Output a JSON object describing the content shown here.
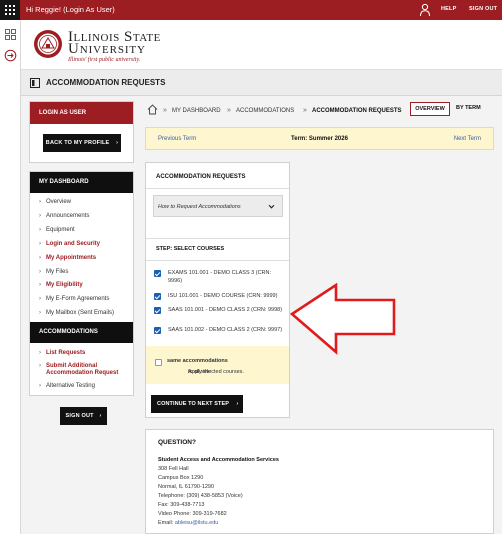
{
  "topbar": {
    "greeting": "Hi Reggie! (Login As User)",
    "help": "HELP",
    "sign_out": "SIGN OUT"
  },
  "header": {
    "wordmark_line1": "Illinois State",
    "wordmark_line2": "University",
    "tagline": "Illinois' first public university."
  },
  "page_title": "ACCOMMODATION REQUESTS",
  "sidebar": {
    "login_as_user": "LOGIN AS USER",
    "back_button": "BACK TO MY PROFILE",
    "dashboard_heading": "MY DASHBOARD",
    "dashboard_items": [
      {
        "label": "Overview",
        "highlight": false
      },
      {
        "label": "Announcements",
        "highlight": false
      },
      {
        "label": "Equipment",
        "highlight": false
      },
      {
        "label": "Login and Security",
        "highlight": true
      },
      {
        "label": "My Appointments",
        "highlight": true
      },
      {
        "label": "My Files",
        "highlight": false
      },
      {
        "label": "My Eligibility",
        "highlight": true
      },
      {
        "label": "My E-Form Agreements",
        "highlight": false
      },
      {
        "label": "My Mailbox (Sent Emails)",
        "highlight": false
      }
    ],
    "accommodations_heading": "ACCOMMODATIONS",
    "accommodation_items": [
      {
        "label": "List Requests",
        "highlight": true
      },
      {
        "label_line1": "Submit Additional",
        "label_line2": "Accommodation Request",
        "highlight": true
      },
      {
        "label": "Alternative Testing",
        "highlight": false
      }
    ],
    "sign_out_button": "SIGN OUT"
  },
  "breadcrumb": {
    "items": [
      "MY DASHBOARD",
      "ACCOMMODATIONS",
      "ACCOMMODATION REQUESTS"
    ],
    "separator": "»"
  },
  "view_toggle": {
    "overview": "OVERVIEW",
    "by_term": "BY TERM"
  },
  "term_bar": {
    "previous": "Previous Term",
    "current": "Term: Summer 2026",
    "next": "Next Term"
  },
  "accommodation_panel": {
    "title": "ACCOMMODATION REQUESTS",
    "how_to_select": "How to Request Accommodations",
    "step_title": "STEP: SELECT COURSES",
    "courses": [
      {
        "label": "EXAMS 101.001 - DEMO CLASS 3 (CRN: 9996)",
        "checked": true
      },
      {
        "label": "ISU 101.001 - DEMO COURSE (CRN: 9999)",
        "checked": true
      },
      {
        "label": "SAAS 101.001 - DEMO CLASS 2 (CRN: 9998)",
        "checked": true
      },
      {
        "label": "SAAS 101.002 - DEMO CLASS 2 (CRN: 9997)",
        "checked": true
      }
    ],
    "apply_prefix": "Apply the ",
    "apply_bold": "same accommodations",
    "apply_suffix": " to all selected courses.",
    "apply_checked": false,
    "continue_button": "CONTINUE TO NEXT STEP"
  },
  "question_box": {
    "title": "QUESTION?",
    "office": "Student Access and Accommodation Services",
    "address1": "308 Fell Hall",
    "address2": "Campus Box 1290",
    "address3": "Normal, IL 61790-1290",
    "telephone": "Telephone: (309) 438-5853 (Voice)",
    "fax": "Fax: 309-438-7713",
    "video_phone": "Video Phone: 309-319-7682",
    "email_label": "Email: ",
    "email": "ableisu@ilstu.edu"
  },
  "colors": {
    "brand_red": "#9d1e22",
    "dark": "#111111",
    "highlight_yellow": "#fdf6cf",
    "link_blue": "#3a5fa5",
    "check_blue": "#1a5fb4",
    "arrow_red": "#e01b1b"
  },
  "icons": [
    "grid-icon",
    "user-icon",
    "dashboard-icon",
    "logout-icon",
    "university-seal-icon",
    "page-icon",
    "home-icon",
    "chevron-down-icon",
    "chevron-right-icon"
  ]
}
